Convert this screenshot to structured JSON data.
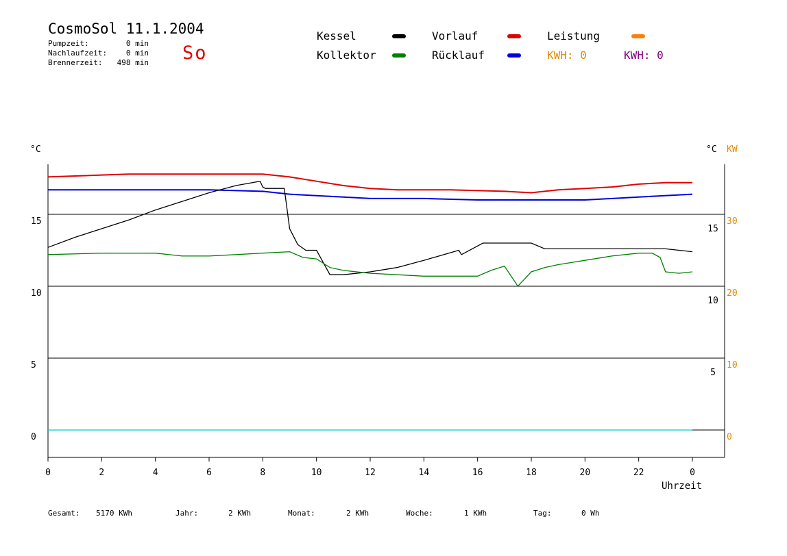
{
  "header": {
    "title": "CosmoSol 11.1.2004",
    "day": "So",
    "stats": [
      {
        "label": "Pumpzeit:",
        "value": "0 min"
      },
      {
        "label": "Nachlaufzeit:",
        "value": "0 min"
      },
      {
        "label": "Brennerzeit:",
        "value": "498 min"
      }
    ]
  },
  "legend": [
    {
      "label": "Kessel",
      "color": "#000000"
    },
    {
      "label": "Kollektor",
      "color": "#008000"
    },
    {
      "label": "Vorlauf",
      "color": "#e00000"
    },
    {
      "label": "Rücklauf",
      "color": "#0000e0"
    },
    {
      "label": "Leistung",
      "color": "#ff8000"
    },
    {
      "label": "KWH: 0",
      "color": "#e08a00"
    },
    {
      "label": "KWH: 0",
      "color": "#800080"
    }
  ],
  "footer": [
    {
      "label": "Gesamt:",
      "value": "5170 KWh"
    },
    {
      "label": "Jahr:",
      "value": "2 KWh"
    },
    {
      "label": "Monat:",
      "value": "2 KWh"
    },
    {
      "label": "Woche:",
      "value": "1 KWh"
    },
    {
      "label": "Tag:",
      "value": "0 Wh"
    }
  ],
  "chart_data": {
    "type": "line",
    "title": "CosmoSol 11.1.2004",
    "xlabel": "Uhrzeit",
    "ylabel_left": "°C",
    "ylabel_right": "°C",
    "ylabel_power": "KW",
    "xlim": [
      0,
      24
    ],
    "ylim": [
      -3,
      19
    ],
    "x_ticks": [
      "0",
      "2",
      "4",
      "6",
      "8",
      "10",
      "12",
      "14",
      "16",
      "18",
      "20",
      "22",
      "0"
    ],
    "y_ticks_left": [
      "0",
      "5",
      "10",
      "15"
    ],
    "y_ticks_right": [
      "5",
      "10",
      "15"
    ],
    "y_ticks_power": [
      "0",
      "10",
      "20",
      "30"
    ],
    "grid_lines_y": [
      0,
      5,
      10,
      15
    ],
    "series": [
      {
        "name": "Vorlauf",
        "color": "#e00000",
        "x": [
          0,
          3,
          6,
          8,
          9,
          10,
          11,
          12,
          13,
          15,
          17,
          18,
          19,
          20,
          21,
          22,
          23,
          24
        ],
        "y": [
          17.6,
          17.8,
          17.8,
          17.8,
          17.6,
          17.3,
          17.0,
          16.8,
          16.7,
          16.7,
          16.6,
          16.5,
          16.7,
          16.8,
          16.9,
          17.1,
          17.2,
          17.2
        ]
      },
      {
        "name": "Rücklauf",
        "color": "#0000e0",
        "x": [
          0,
          3,
          6,
          8,
          9,
          10,
          11,
          12,
          14,
          16,
          18,
          20,
          22,
          24
        ],
        "y": [
          16.7,
          16.7,
          16.7,
          16.6,
          16.4,
          16.3,
          16.2,
          16.1,
          16.1,
          16.0,
          16.0,
          16.0,
          16.2,
          16.4
        ]
      },
      {
        "name": "Kessel",
        "color": "#000000",
        "x": [
          0,
          1,
          2,
          3,
          4,
          5,
          6,
          7,
          7.9,
          8.0,
          8.1,
          8.8,
          9.0,
          9.3,
          9.6,
          10.0,
          10.5,
          11,
          12,
          13,
          14,
          15.3,
          15.4,
          16.2,
          17,
          18,
          18.5,
          19,
          20,
          21,
          22,
          23,
          24
        ],
        "y": [
          12.7,
          13.4,
          14.0,
          14.6,
          15.3,
          15.9,
          16.5,
          17.0,
          17.3,
          16.9,
          16.8,
          16.8,
          14.0,
          12.9,
          12.5,
          12.5,
          10.8,
          10.8,
          11.0,
          11.3,
          11.8,
          12.5,
          12.2,
          13.0,
          13.0,
          13.0,
          12.6,
          12.6,
          12.6,
          12.6,
          12.6,
          12.6,
          12.4
        ]
      },
      {
        "name": "Kollektor",
        "color": "#008000",
        "x": [
          0,
          2,
          4,
          5,
          6,
          7,
          8,
          9,
          9.5,
          10,
          10.5,
          11,
          12,
          13,
          14,
          15,
          16,
          16.5,
          17,
          17.5,
          18,
          18.5,
          19,
          20,
          21,
          22,
          22.5,
          22.8,
          23,
          23.5,
          24
        ],
        "y": [
          12.2,
          12.3,
          12.3,
          12.1,
          12.1,
          12.2,
          12.3,
          12.4,
          12.0,
          11.9,
          11.3,
          11.1,
          10.9,
          10.8,
          10.7,
          10.7,
          10.7,
          11.1,
          11.4,
          10.0,
          11.0,
          11.3,
          11.5,
          11.8,
          12.1,
          12.3,
          12.3,
          12.0,
          11.0,
          10.9,
          11.0
        ]
      },
      {
        "name": "Leistung",
        "color": "#00cccc",
        "x": [
          0,
          24
        ],
        "y": [
          0,
          0
        ]
      }
    ]
  }
}
